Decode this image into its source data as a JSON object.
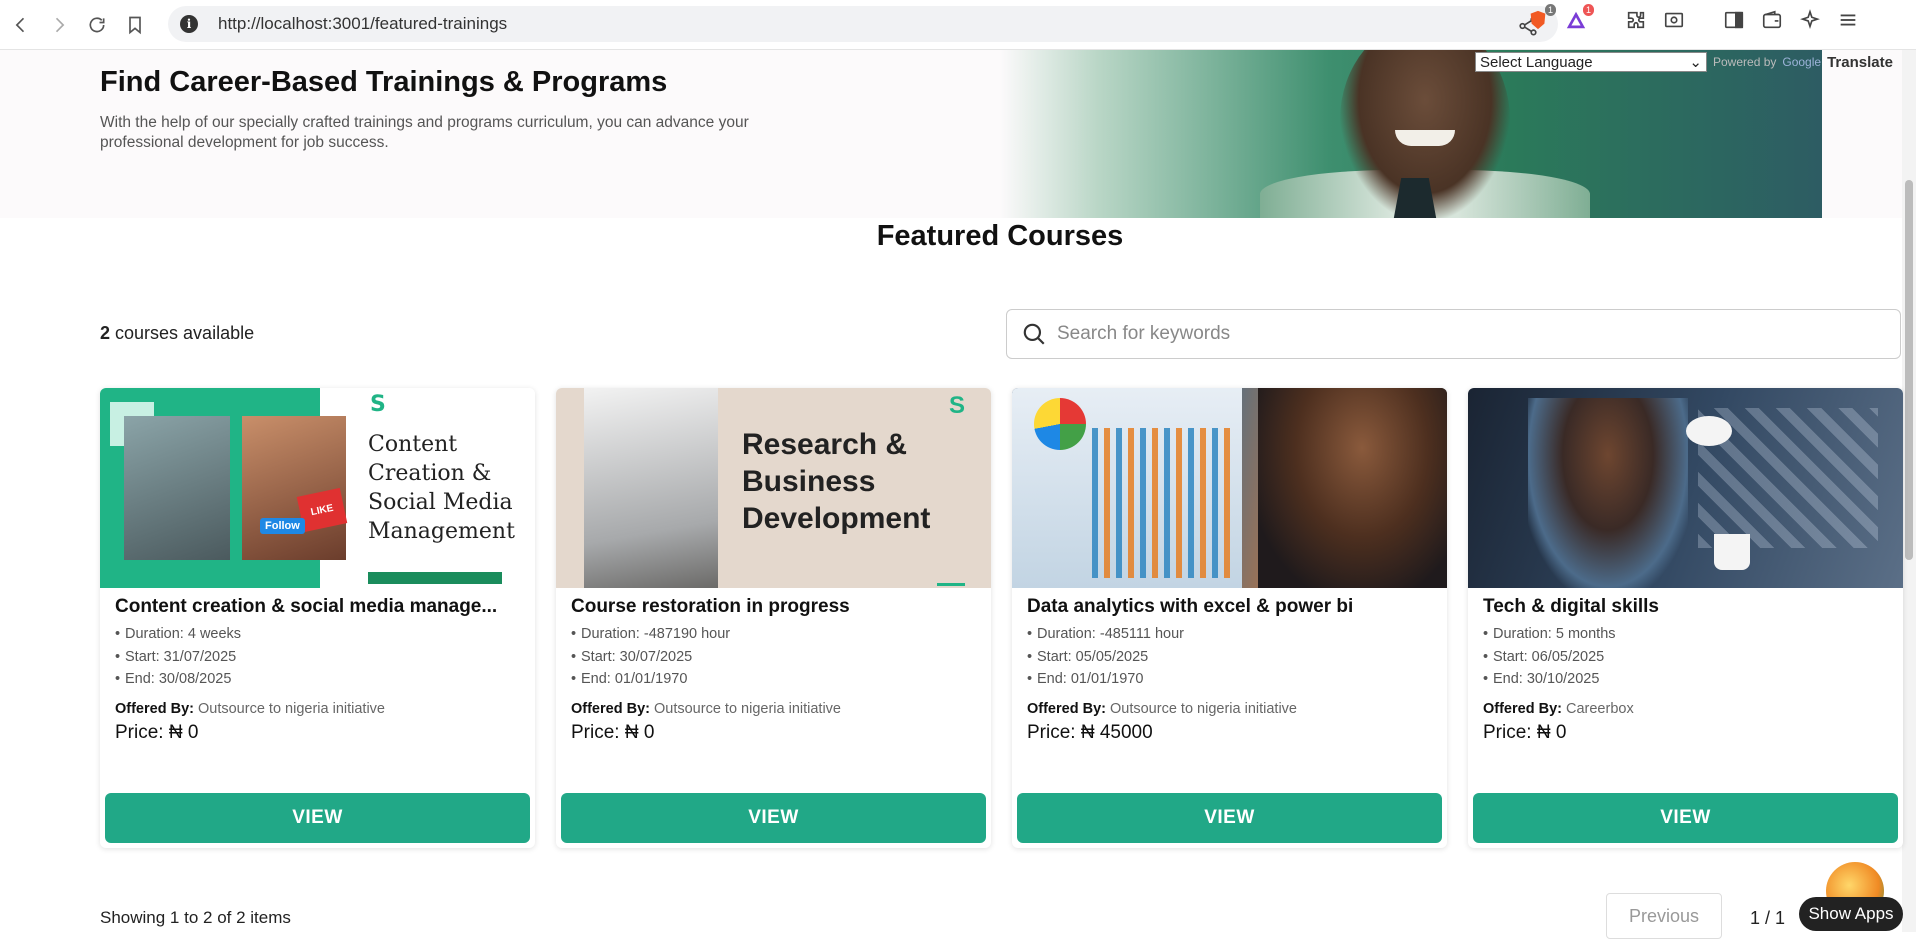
{
  "browser": {
    "url": "http://localhost:3001/featured-trainings",
    "info_icon": "i",
    "brave_badge": "1",
    "alert_badge": "1"
  },
  "hero": {
    "title": "Find Career-Based Trainings & Programs",
    "subtitle": "With the help of our specially crafted trainings and programs curriculum, you can advance your professional development for job success."
  },
  "translate": {
    "select_label": "Select Language",
    "powered": "Powered by",
    "google": "Google",
    "translate": "Translate"
  },
  "featured": {
    "title": "Featured Courses",
    "count": "2",
    "count_suffix": " courses available",
    "search_placeholder": "Search for keywords"
  },
  "courses": [
    {
      "title": "Content creation & social media manage...",
      "image_text": [
        "Content",
        "Creation &",
        "Social Media",
        "Management"
      ],
      "image_like": "LIKE",
      "image_follow": "Follow",
      "duration": "Duration: 4 weeks",
      "start": "Start: 31/07/2025",
      "end": "End: 30/08/2025",
      "offered_label": "Offered By:",
      "offered_by": "Outsource to nigeria initiative",
      "price": "Price: ₦ 0",
      "button": "VIEW"
    },
    {
      "title": "Course restoration in progress",
      "image_text": [
        "Research &",
        "Business",
        "Development"
      ],
      "duration": "Duration: -487190 hour",
      "start": "Start: 30/07/2025",
      "end": "End: 01/01/1970",
      "offered_label": "Offered By:",
      "offered_by": "Outsource to nigeria initiative",
      "price": "Price: ₦ 0",
      "button": "VIEW"
    },
    {
      "title": "Data analytics with excel & power bi",
      "duration": "Duration: -485111 hour",
      "start": "Start: 05/05/2025",
      "end": "End: 01/01/1970",
      "offered_label": "Offered By:",
      "offered_by": "Outsource to nigeria initiative",
      "price": "Price: ₦ 45000",
      "button": "VIEW"
    },
    {
      "title": "Tech & digital skills",
      "duration": "Duration: 5 months",
      "start": "Start: 06/05/2025",
      "end": "End: 30/10/2025",
      "offered_label": "Offered By:",
      "offered_by": "Careerbox",
      "price": "Price: ₦ 0",
      "button": "VIEW"
    }
  ],
  "pagination": {
    "showing": "Showing 1 to 2 of 2 items",
    "previous": "Previous",
    "page": "1 / 1"
  },
  "floating": {
    "show_apps": "Show Apps"
  },
  "colors": {
    "accent": "#21a887",
    "brand_green": "#20b486"
  }
}
